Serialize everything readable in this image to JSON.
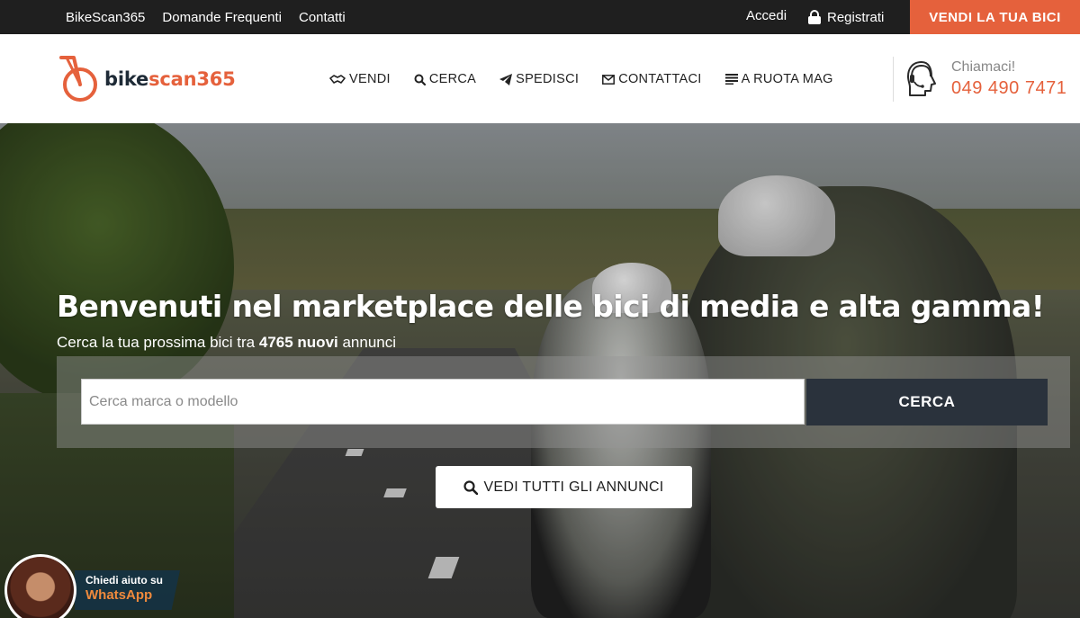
{
  "topbar": {
    "links": [
      "BikeScan365",
      "Domande Frequenti",
      "Contatti"
    ],
    "login": "Accedi",
    "register": "Registrati",
    "sell_button": "VENDI LA TUA BICI"
  },
  "header": {
    "logo_part1": "bike",
    "logo_part2": "scan365",
    "nav": [
      {
        "label": "VENDI",
        "icon": "handshake-icon"
      },
      {
        "label": "CERCA",
        "icon": "search-icon"
      },
      {
        "label": "SPEDISCI",
        "icon": "paper-plane-icon"
      },
      {
        "label": "CONTATTACI",
        "icon": "envelope-icon"
      },
      {
        "label": "A RUOTA MAG",
        "icon": "list-icon"
      }
    ],
    "call_label": "Chiamaci!",
    "phone": "049 490 7471"
  },
  "hero": {
    "title": "Benvenuti nel marketplace delle bici di media e alta gamma!",
    "subtitle_before": "Cerca la tua prossima bici tra ",
    "subtitle_count": "4765 nuovi",
    "subtitle_after": " annunci",
    "search_placeholder": "Cerca marca o modello",
    "search_button": "CERCA",
    "all_button": "VEDI TUTTI GLI ANNUNCI"
  },
  "whatsapp": {
    "line1": "Chiedi aiuto su",
    "line2": "WhatsApp"
  },
  "colors": {
    "accent": "#e5613c",
    "dark": "#1f1f1f",
    "search_button": "#2a323c"
  }
}
